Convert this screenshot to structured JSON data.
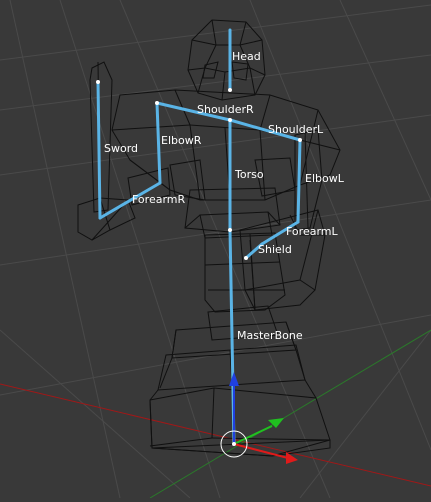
{
  "colors": {
    "background": "#393939",
    "grid": "#4a4a4a",
    "wire": "#101010",
    "bone": "#5ab4e6",
    "bone_joint": "#ffffff",
    "axis_x": "#a01818",
    "axis_y": "#208a20",
    "arrow_x": "#e01a1a",
    "arrow_y": "#20c020",
    "arrow_z": "#2040e0",
    "label": "#ffffff"
  },
  "bones": {
    "head": "Head",
    "shoulder_r": "ShoulderR",
    "shoulder_l": "ShoulderL",
    "elbow_r": "ElbowR",
    "elbow_l": "ElbowL",
    "sword": "Sword",
    "torso": "Torso",
    "forearm_r": "ForearmR",
    "forearm_l": "ForearmL",
    "shield": "Shield",
    "master_bone": "MasterBone"
  },
  "icons": {
    "manipulator": "transform-manipulator-icon",
    "cursor_3d": "3d-cursor-icon"
  }
}
